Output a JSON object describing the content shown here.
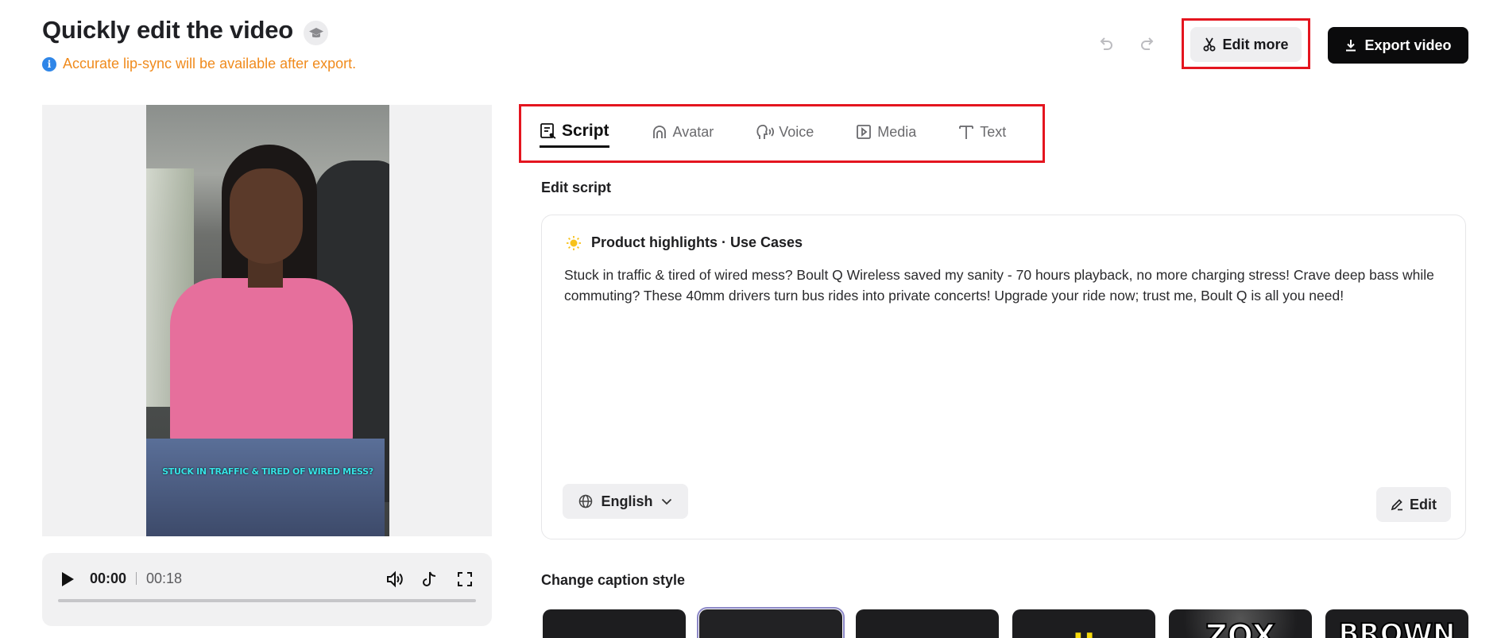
{
  "header": {
    "title": "Quickly edit the video",
    "title_badge_icon": "graduation-cap-icon",
    "notice": "Accurate lip-sync will be available after export.",
    "notice_color": "#f08b1d",
    "undo_icon": "undo-icon",
    "redo_icon": "redo-icon",
    "edit_more_label": "Edit more",
    "export_label": "Export video"
  },
  "video": {
    "caption_overlay": "STUCK IN TRAFFIC & TIRED OF WIRED MESS?"
  },
  "player": {
    "current_time": "00:00",
    "total_time": "00:18",
    "progress": 0,
    "controls": [
      "volume-icon",
      "tiktok-icon",
      "fullscreen-icon"
    ]
  },
  "tabs": [
    {
      "label": "Script",
      "icon": "script-icon",
      "active": true
    },
    {
      "label": "Avatar",
      "icon": "avatar-icon",
      "active": false
    },
    {
      "label": "Voice",
      "icon": "voice-icon",
      "active": false
    },
    {
      "label": "Media",
      "icon": "media-icon",
      "active": false
    },
    {
      "label": "Text",
      "icon": "text-icon",
      "active": false
    }
  ],
  "script": {
    "section_title": "Edit script",
    "card_title": "Product highlights · Use Cases",
    "card_icon": "sun-icon",
    "body": "Stuck in traffic & tired of wired mess? Boult Q Wireless saved my sanity - 70 hours playback, no more charging stress! Crave deep bass while commuting? These 40mm drivers turn bus rides into private concerts! Upgrade your ride now; trust me, Boult Q is all you need!",
    "language": "English",
    "edit_label": "Edit"
  },
  "caption_styles": {
    "section_title": "Change caption style",
    "tiles": [
      {
        "sample": " ",
        "color": "#ffffff",
        "selected": false
      },
      {
        "sample": "",
        "color": "#ffffff",
        "selected": true
      },
      {
        "sample": "",
        "color": "#ffffff",
        "selected": false
      },
      {
        "sample": "··",
        "color": "#f5d90a",
        "selected": false
      },
      {
        "sample": "ZOX",
        "color": "#ffffff",
        "selected": false
      },
      {
        "sample": "BROWN",
        "color": "#ffffff",
        "selected": false
      }
    ]
  },
  "colors": {
    "accent_red_frame": "#e4151f",
    "export_bg": "#0b0b0c",
    "info_blue": "#2f86e8"
  }
}
